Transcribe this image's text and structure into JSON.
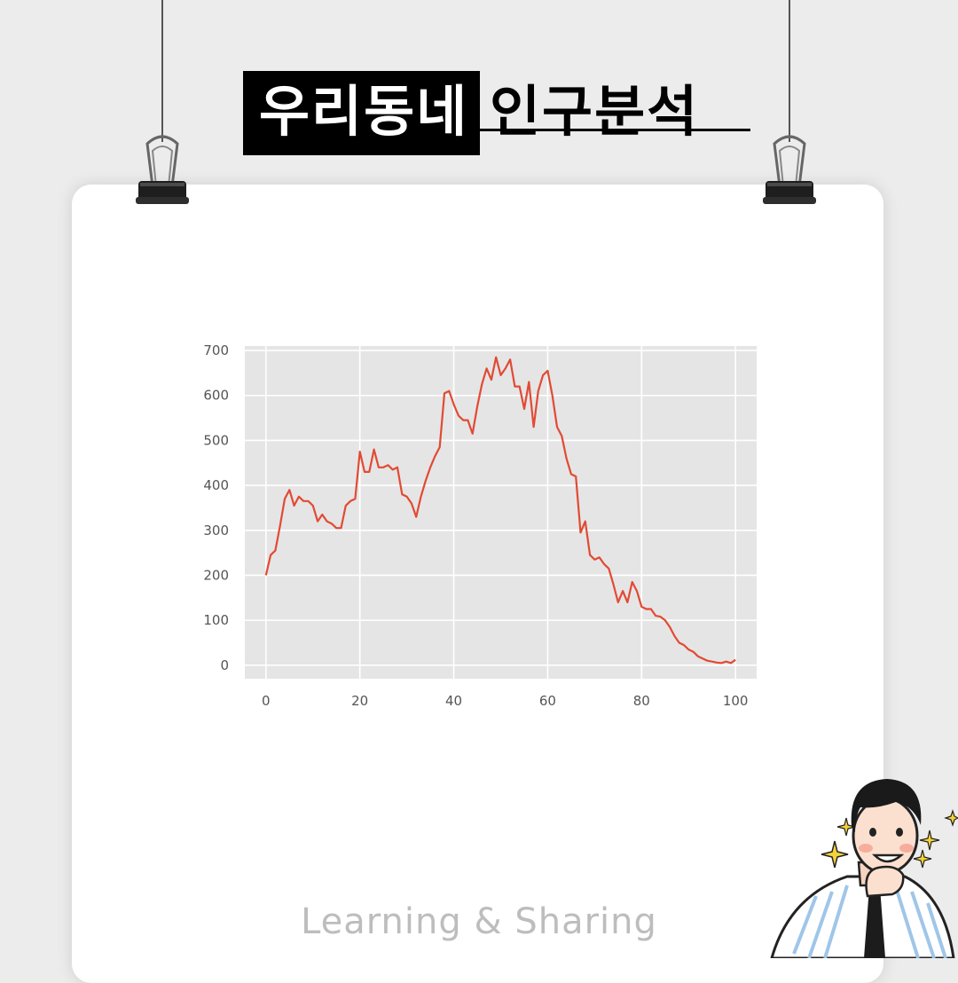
{
  "title": {
    "highlight": "우리동네",
    "rest": "인구분석"
  },
  "footer": "Learning & Sharing",
  "chart_data": {
    "type": "line",
    "x_ticks": [
      "0",
      "20",
      "40",
      "60",
      "80",
      "100"
    ],
    "y_ticks": [
      "0",
      "100",
      "200",
      "300",
      "400",
      "500",
      "600",
      "700"
    ],
    "xlim": [
      -4.5,
      104.5
    ],
    "ylim": [
      -30,
      710
    ],
    "grid": true,
    "series": [
      {
        "color": "#e24a33",
        "x": [
          0,
          1,
          2,
          3,
          4,
          5,
          6,
          7,
          8,
          9,
          10,
          11,
          12,
          13,
          14,
          15,
          16,
          17,
          18,
          19,
          20,
          21,
          22,
          23,
          24,
          25,
          26,
          27,
          28,
          29,
          30,
          31,
          32,
          33,
          34,
          35,
          36,
          37,
          38,
          39,
          40,
          41,
          42,
          43,
          44,
          45,
          46,
          47,
          48,
          49,
          50,
          51,
          52,
          53,
          54,
          55,
          56,
          57,
          58,
          59,
          60,
          61,
          62,
          63,
          64,
          65,
          66,
          67,
          68,
          69,
          70,
          71,
          72,
          73,
          74,
          75,
          76,
          77,
          78,
          79,
          80,
          81,
          82,
          83,
          84,
          85,
          86,
          87,
          88,
          89,
          90,
          91,
          92,
          93,
          94,
          95,
          96,
          97,
          98,
          99,
          100
        ],
        "y": [
          200,
          245,
          255,
          310,
          370,
          390,
          355,
          375,
          365,
          365,
          355,
          320,
          335,
          320,
          315,
          305,
          305,
          355,
          365,
          370,
          475,
          430,
          430,
          480,
          440,
          440,
          445,
          435,
          440,
          380,
          375,
          360,
          330,
          375,
          410,
          440,
          465,
          485,
          605,
          610,
          580,
          555,
          545,
          545,
          515,
          575,
          625,
          660,
          635,
          685,
          645,
          660,
          680,
          620,
          620,
          570,
          630,
          530,
          610,
          645,
          655,
          600,
          530,
          510,
          460,
          425,
          420,
          295,
          320,
          245,
          235,
          240,
          225,
          215,
          180,
          140,
          165,
          140,
          185,
          165,
          130,
          125,
          125,
          110,
          108,
          100,
          85,
          65,
          50,
          45,
          35,
          30,
          20,
          15,
          10,
          8,
          6,
          5,
          8,
          5,
          12
        ]
      }
    ]
  }
}
